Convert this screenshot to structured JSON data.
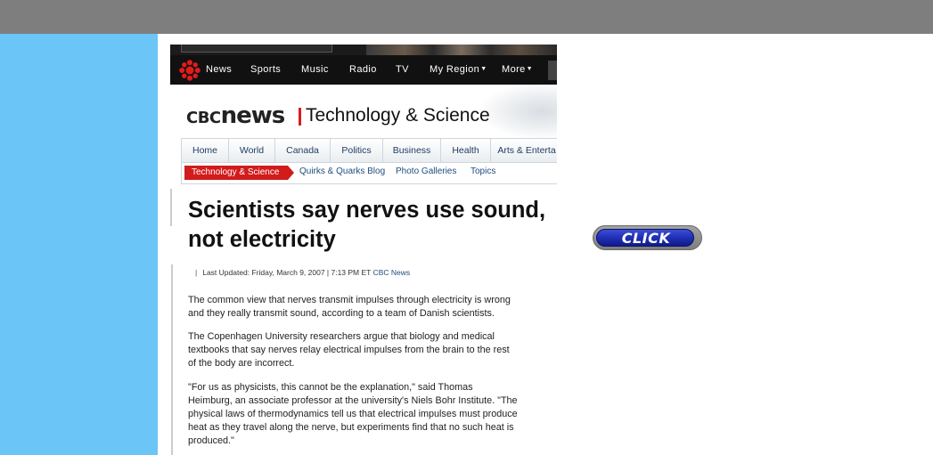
{
  "cbc_nav": {
    "items": [
      "News",
      "Sports",
      "Music",
      "Radio",
      "TV",
      "My Region",
      "More"
    ]
  },
  "header": {
    "logo_cbc": "CBC",
    "logo_news": "news",
    "section_title": "Technology & Science"
  },
  "subnav": {
    "tabs": [
      "Home",
      "World",
      "Canada",
      "Politics",
      "Business",
      "Health",
      "Arts & Enterta"
    ],
    "active": "Technology & Science",
    "links": [
      "Quirks & Quarks Blog",
      "Photo Galleries",
      "Topics"
    ]
  },
  "article": {
    "headline": "Scientists say nerves use sound, not electricity",
    "updated": "Last Updated: Friday, March 9, 2007 | 7:13 PM ET",
    "source": "CBC News",
    "paragraphs": [
      "The common view that nerves transmit impulses through electricity is wrong and they really transmit sound, according to a team of Danish scientists.",
      "The Copenhagen University researchers argue that biology and medical textbooks that say nerves relay electrical impulses from the brain to the rest of the body are incorrect.",
      "\"For us as physicists, this cannot be the explanation,\" said Thomas Heimburg, an associate professor at the university's Niels Bohr Institute. \"The physical laws of thermodynamics tell us that electrical impulses must produce heat as they travel along the nerve, but experiments find that no such heat is produced.\""
    ]
  },
  "click_button": {
    "label": "CLICK"
  },
  "colors": {
    "top_bar": "#7e7e7e",
    "left_panel": "#6cc5f7",
    "cbc_red": "#d21b1b",
    "button_blue": "#2232b9"
  }
}
